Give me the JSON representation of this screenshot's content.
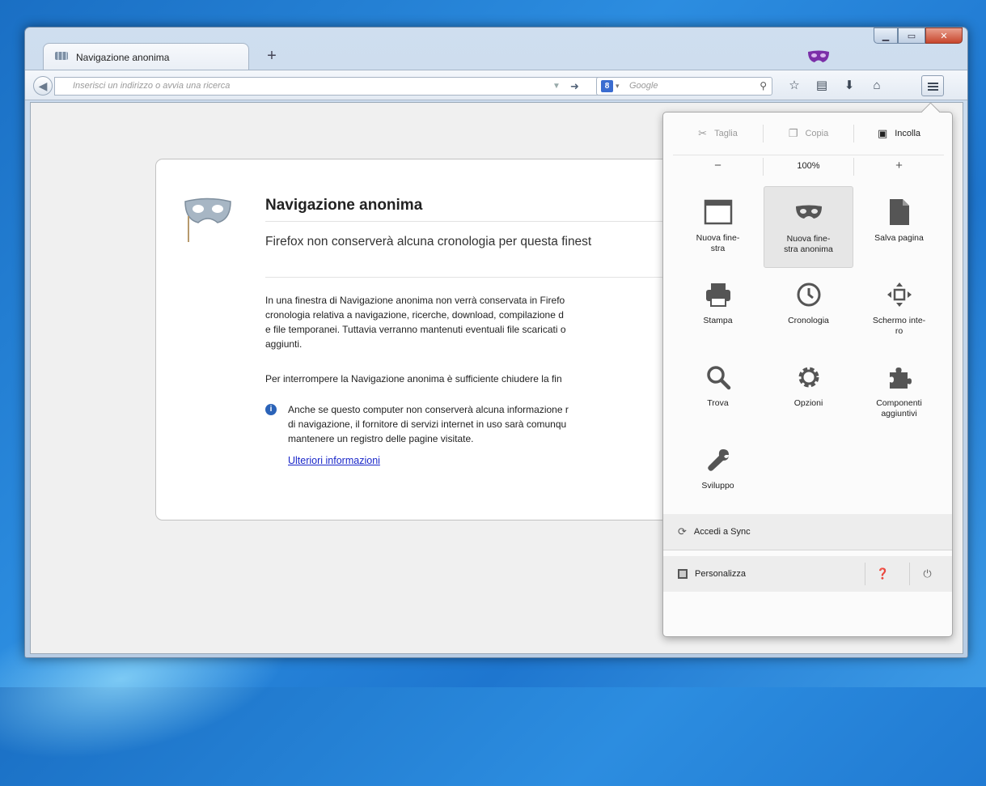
{
  "window": {
    "tab_title": "Navigazione anonima",
    "new_tab_label": "+"
  },
  "toolbar": {
    "url_placeholder": "Inserisci un indirizzo o avvia una ricerca",
    "search_engine": "Google",
    "search_placeholder": "Google"
  },
  "page": {
    "title": "Navigazione anonima",
    "subtitle": "Firefox non conserverà alcuna cronologia per questa finest",
    "paragraph1_lines": [
      "In una finestra di Navigazione anonima non verrà conservata in Firefo",
      "cronologia relativa a navigazione, ricerche, download, compilazione d",
      "e file temporanei. Tuttavia verranno mantenuti eventuali file scaricati o",
      "aggiunti."
    ],
    "paragraph2": "Per interrompere la Navigazione anonima è sufficiente chiudere la fin",
    "note_lines": [
      "Anche se questo computer non conserverà alcuna informazione r",
      "di navigazione, il fornitore di servizi internet in uso sarà comunqu",
      "mantenere un registro delle pagine visitate."
    ],
    "link": "Ulteriori informazioni"
  },
  "menu": {
    "cut": "Taglia",
    "copy": "Copia",
    "paste": "Incolla",
    "zoom_out": "−",
    "zoom_level": "100%",
    "zoom_in": "+",
    "tiles": [
      {
        "label": "Nuova fine-\nstra",
        "icon": "window-icon"
      },
      {
        "label": "Nuova fine-\nstra anonima",
        "icon": "mask-icon"
      },
      {
        "label": "Salva pagina",
        "icon": "page-icon"
      },
      {
        "label": "Stampa",
        "icon": "printer-icon"
      },
      {
        "label": "Cronologia",
        "icon": "clock-icon"
      },
      {
        "label": "Schermo inte-\nro",
        "icon": "fullscreen-icon"
      },
      {
        "label": "Trova",
        "icon": "magnifier-icon"
      },
      {
        "label": "Opzioni",
        "icon": "gear-icon"
      },
      {
        "label": "Componenti\naggiuntivi",
        "icon": "puzzle-icon"
      },
      {
        "label": "Sviluppo",
        "icon": "wrench-icon"
      }
    ],
    "sync": "Accedi a Sync",
    "customize": "Personalizza"
  },
  "colors": {
    "desktop": "#1e76cf",
    "link": "#1a27c9",
    "info_dot": "#2b63b8",
    "private_mask": "#7b2fa8"
  }
}
